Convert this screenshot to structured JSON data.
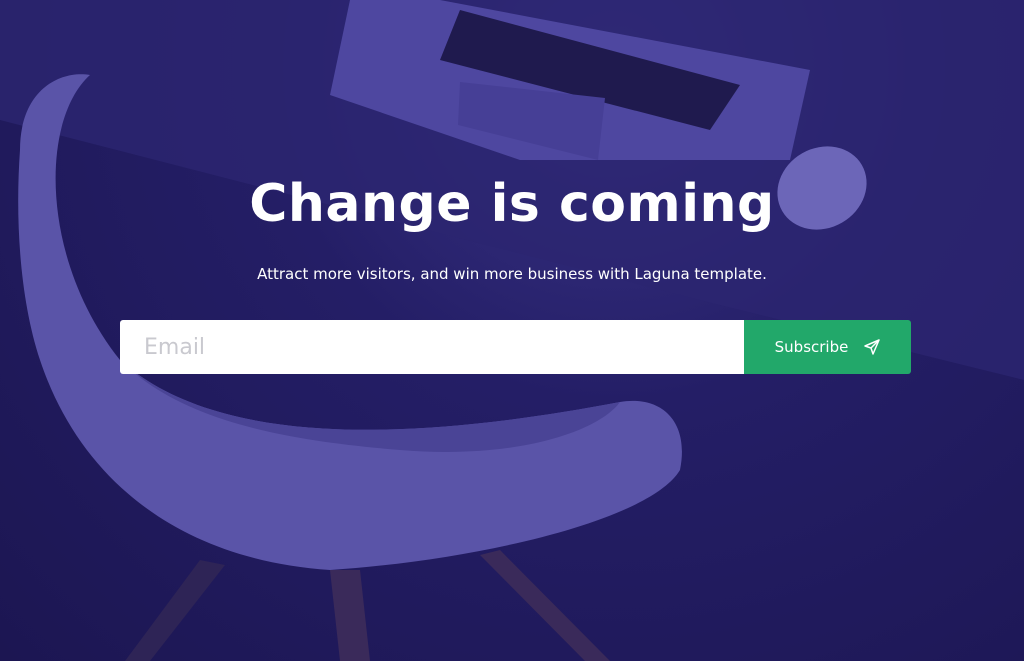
{
  "hero": {
    "title": "Change is coming",
    "subtitle": "Attract more visitors, and win more business with Laguna template."
  },
  "form": {
    "email_placeholder": "Email",
    "email_value": "",
    "subscribe_label": "Subscribe",
    "subscribe_icon": "send-icon"
  },
  "colors": {
    "overlay": "#1e1858",
    "button": "#22a86a",
    "text": "#ffffff"
  }
}
